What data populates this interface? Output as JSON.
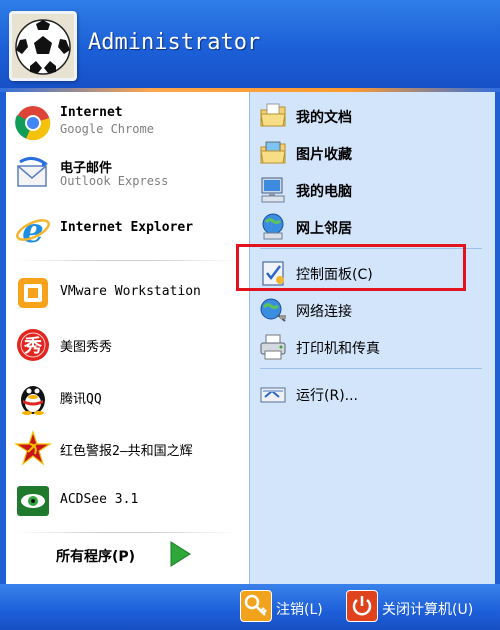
{
  "user": {
    "name": "Administrator"
  },
  "pinned": [
    {
      "title": "Internet",
      "subtitle": "Google Chrome",
      "icon": "chrome-icon"
    },
    {
      "title": "电子邮件",
      "subtitle": "Outlook Express",
      "icon": "outlook-express-icon"
    }
  ],
  "recent": [
    {
      "title": "Internet Explorer",
      "icon": "internet-explorer-icon"
    },
    {
      "title": "VMware Workstation",
      "icon": "vmware-icon"
    },
    {
      "title": "美图秀秀",
      "icon": "meitu-icon"
    },
    {
      "title": "腾讯QQ",
      "icon": "qq-icon"
    },
    {
      "title": "红色警报2—共和国之辉",
      "icon": "red-alert-icon"
    },
    {
      "title": "ACDSee 3.1",
      "icon": "acdsee-icon"
    }
  ],
  "all_programs": {
    "label": "所有程序(P)"
  },
  "places": [
    {
      "label": "我的文档",
      "icon": "my-documents-icon"
    },
    {
      "label": "图片收藏",
      "icon": "my-pictures-icon"
    },
    {
      "label": "我的电脑",
      "icon": "my-computer-icon"
    },
    {
      "label": "网上邻居",
      "icon": "network-places-icon"
    }
  ],
  "system": [
    {
      "label": "控制面板(C)",
      "icon": "control-panel-icon"
    },
    {
      "label": "网络连接",
      "icon": "network-connections-icon"
    },
    {
      "label": "打印机和传真",
      "icon": "printers-icon"
    }
  ],
  "run": {
    "label": "运行(R)...",
    "icon": "run-icon"
  },
  "footer": {
    "logoff": "注销(L)",
    "shutdown": "关闭计算机(U)"
  },
  "colors": {
    "header": "#1c5fd7",
    "right_panel": "#d3e5fa",
    "highlight": "#e1141d",
    "separator_orange": "#ff9a2e"
  }
}
